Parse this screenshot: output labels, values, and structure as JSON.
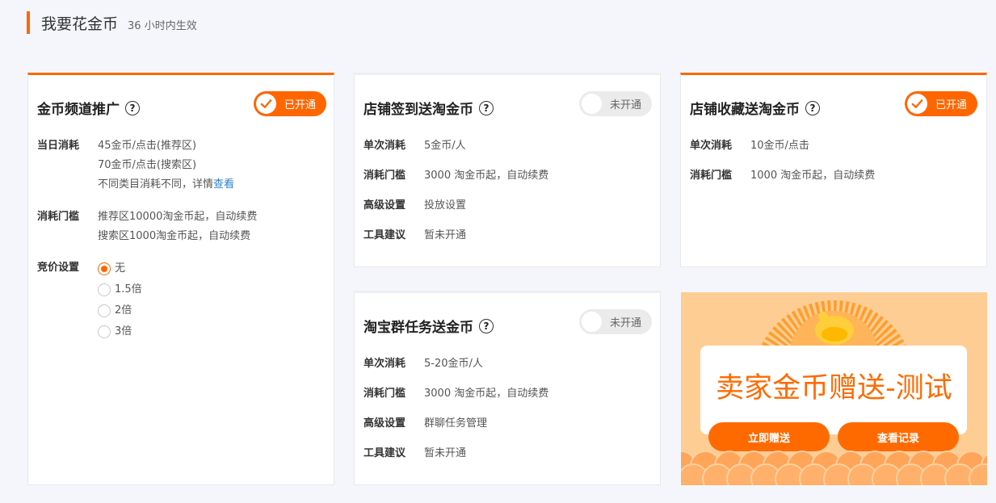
{
  "header": {
    "title": "我要花金币",
    "subtitle": "36 小时内生效"
  },
  "colors": {
    "accent": "#ff6600",
    "link": "#2f7fc9",
    "toggle_off": "#ebebeb"
  },
  "cards": {
    "channel": {
      "title": "金币频道推广",
      "toggle": {
        "label": "已开通",
        "on": true
      },
      "daily_cost_label": "当日消耗",
      "daily_cost_line1": "45金币/点击(推荐区)",
      "daily_cost_line2": "70金币/点击(搜索区)",
      "daily_cost_line3_prefix": "不同类目消耗不同，详情",
      "daily_cost_link": "查看",
      "threshold_label": "消耗门槛",
      "threshold_line1": "推荐区10000淘金币起，自动续费",
      "threshold_line2": "搜索区1000淘金币起，自动续费",
      "bid_label": "竞价设置",
      "bid_options": [
        "无",
        "1.5倍",
        "2倍",
        "3倍"
      ],
      "bid_selected": "无"
    },
    "checkin": {
      "title": "店铺签到送淘金币",
      "toggle": {
        "label": "未开通",
        "on": false
      },
      "cost_label": "单次消耗",
      "cost_value": "5金币/人",
      "threshold_label": "消耗门槛",
      "threshold_value": "3000 淘金币起，自动续费",
      "advanced_label": "高级设置",
      "advanced_link": "投放设置",
      "tool_label": "工具建议",
      "tool_value": "暂未开通"
    },
    "favorite": {
      "title": "店铺收藏送淘金币",
      "toggle": {
        "label": "已开通",
        "on": true
      },
      "cost_label": "单次消耗",
      "cost_value": "10金币/点击",
      "threshold_label": "消耗门槛",
      "threshold_value": "1000 淘金币起，自动续费"
    },
    "group": {
      "title": "淘宝群任务送金币",
      "toggle": {
        "label": "未开通",
        "on": false
      },
      "cost_label": "单次消耗",
      "cost_value": "5-20金币/人",
      "threshold_label": "消耗门槛",
      "threshold_value": "3000 淘金币起，自动续费",
      "advanced_label": "高级设置",
      "advanced_link": "群聊任务管理",
      "tool_label": "工具建议",
      "tool_value": "暂未开通"
    }
  },
  "banner": {
    "headline": "卖家金币赠送-测试",
    "btn_gift": "立即赠送",
    "btn_records": "查看记录"
  }
}
